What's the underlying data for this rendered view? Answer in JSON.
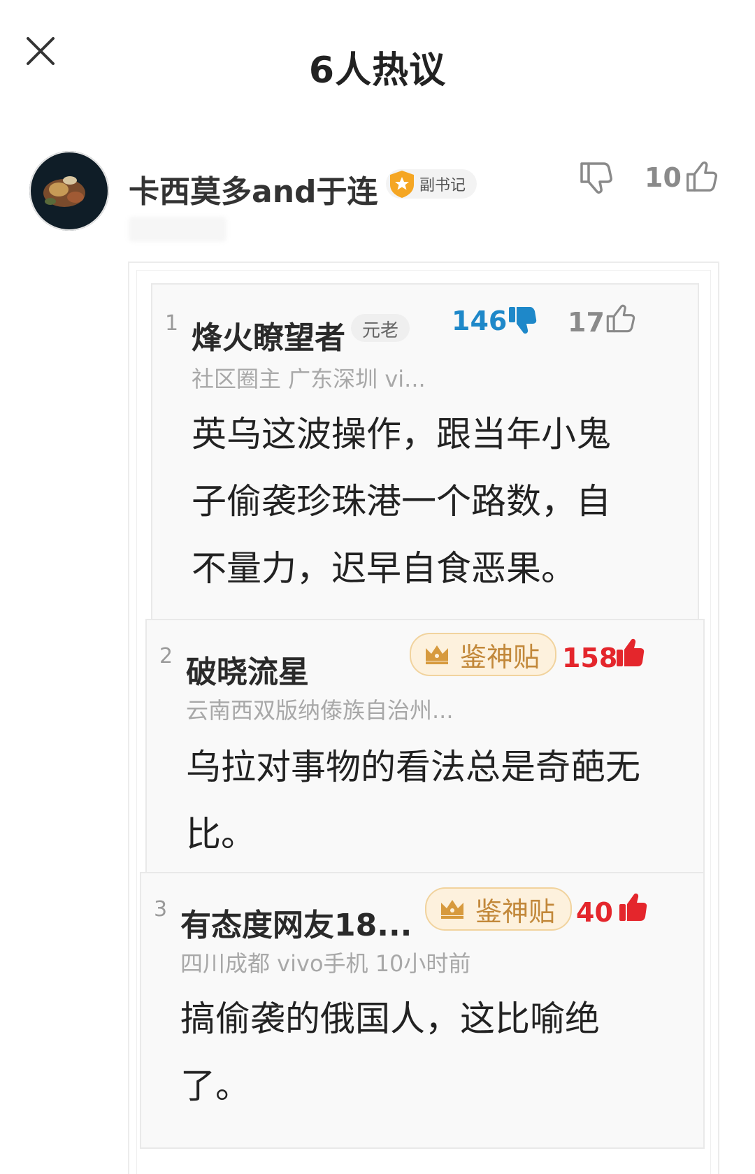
{
  "header": {
    "title": "6人热议"
  },
  "main_comment": {
    "username": "卡西莫多and于连",
    "badge": "副书记",
    "likes": "10"
  },
  "replies": [
    {
      "index": "1",
      "username": "烽火瞭望者",
      "tag": "元老",
      "dislikes": "146",
      "likes": "17",
      "meta": "社区圈主  广东深圳  vi...",
      "body": "英乌这波操作，跟当年小鬼子偷袭珍珠港一个路数，自不量力，迟早自食恶果。"
    },
    {
      "index": "2",
      "username": "破晓流星",
      "god_tag": "鉴神贴",
      "likes": "158",
      "meta": "云南西双版纳傣族自治州...",
      "body": "乌拉对事物的看法总是奇葩无比。"
    },
    {
      "index": "3",
      "username": "有态度网友18...",
      "god_tag": "鉴神贴",
      "likes": "40",
      "meta": "四川成都  vivo手机  10小时前",
      "body": "搞偷袭的俄国人，这比喻绝了。"
    }
  ],
  "colors": {
    "dislike_blue": "#1e88c9",
    "like_red": "#e4262c",
    "god_tag_text": "#c2883a",
    "badge_orange": "#f5a623"
  },
  "icons": {
    "close": "close-icon",
    "thumb_down_outline": "thumb-down-outline-icon",
    "thumb_up_outline": "thumb-up-outline-icon",
    "thumb_down_filled": "thumb-down-filled-icon",
    "thumb_up_filled": "thumb-up-filled-icon",
    "crown": "crown-icon",
    "shield_star": "shield-star-icon"
  }
}
